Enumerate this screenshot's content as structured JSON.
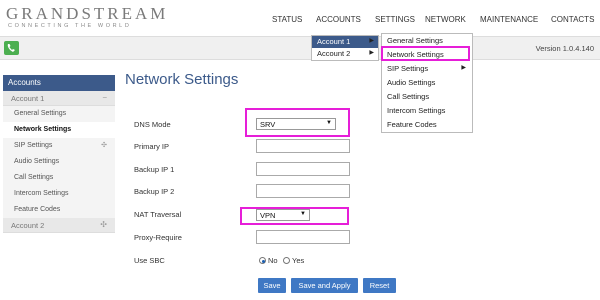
{
  "brand": {
    "name": "GRANDSTREAM",
    "tagline": "CONNECTING THE WORLD"
  },
  "topnav": [
    "STATUS",
    "ACCOUNTS",
    "SETTINGS",
    "NETWORK",
    "MAINTENANCE",
    "CONTACTS"
  ],
  "version": "Version 1.0.4.140",
  "sidebar": {
    "header": "Accounts",
    "groups": [
      {
        "label": "Account 1",
        "symbol": "−",
        "items": [
          "General Settings",
          "Network Settings",
          "SIP Settings",
          "Audio Settings",
          "Call Settings",
          "Intercom Settings",
          "Feature Codes"
        ]
      },
      {
        "label": "Account 2",
        "symbol": "✣"
      }
    ],
    "sip_symbol": "✣"
  },
  "page_title": "Network Settings",
  "form": {
    "dns_mode_label": "DNS Mode",
    "dns_mode_value": "SRV",
    "primary_ip_label": "Primary IP",
    "backup_ip1_label": "Backup IP 1",
    "backup_ip2_label": "Backup IP 2",
    "nat_label": "NAT Traversal",
    "nat_value": "VPN",
    "proxy_require_label": "Proxy-Require",
    "use_sbc_label": "Use SBC",
    "sbc_no": "No",
    "sbc_yes": "Yes",
    "sbc_selected": "No"
  },
  "buttons": {
    "save": "Save",
    "save_apply": "Save and Apply",
    "reset": "Reset"
  },
  "accounts_menu": [
    "Account 1",
    "Account 2"
  ],
  "account_submenu": [
    "General Settings",
    "Network Settings",
    "SIP Settings",
    "Audio Settings",
    "Call Settings",
    "Intercom Settings",
    "Feature Codes"
  ],
  "colors": {
    "highlight": "#e61ed8",
    "accent": "#3c5a8a",
    "button": "#3f78c4"
  }
}
